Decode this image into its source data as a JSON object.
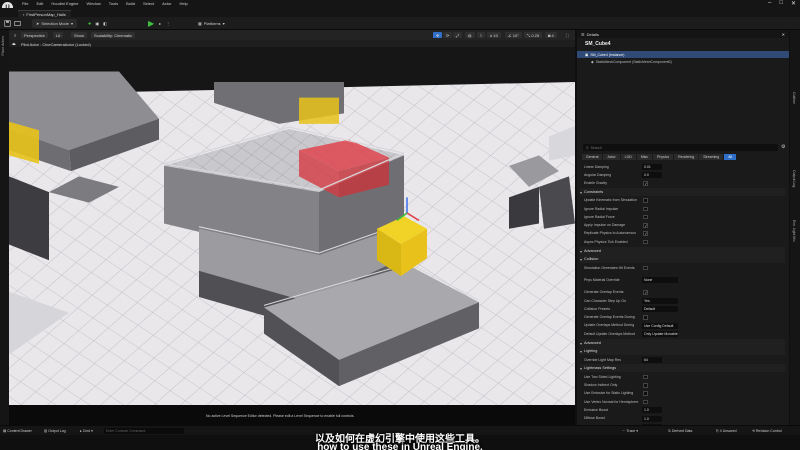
{
  "menubar": {
    "logo": "U",
    "items": [
      "File",
      "Edit",
      "Houdini Engine",
      "Window",
      "Tools",
      "Build",
      "Select",
      "Actor",
      "Help"
    ]
  },
  "tab": {
    "title": "FirstPersonMap_Halls"
  },
  "toolbar": {
    "mode": "Selection Mode",
    "platforms": "Platforms"
  },
  "left_strip": {
    "label": "Place Actors"
  },
  "viewport": {
    "perspective": "Perspective",
    "lit": "Lit",
    "show": "Show",
    "scalability": "Scalability: Cinematic",
    "grid_size": "10",
    "angle": "10°",
    "scale": "0.25",
    "speed": "4",
    "pilot_label": "Pilot Actor : CineCameraActor (Locked)",
    "sequence_message": "No active Level Sequence Editor detected. Please edit a Level Sequence to enable full controls."
  },
  "right_strip": {
    "labels": [
      "Outliner",
      "Output Log",
      "Env. Light Mix"
    ]
  },
  "details": {
    "title": "Details",
    "actor": "SM_Cube4",
    "instance": "SM_Cube4 (Instance)",
    "component": "StaticMeshComponent (StaticMeshComponent0)",
    "search_placeholder": "Search",
    "tabs": [
      "General",
      "Actor",
      "LOD",
      "Misc",
      "Physics",
      "Rendering",
      "Streaming",
      "All"
    ],
    "active_tab": "All",
    "rows": [
      {
        "label": "Linear Damping",
        "value": "0.01",
        "type": "val"
      },
      {
        "label": "Angular Damping",
        "value": "0.0",
        "type": "val"
      },
      {
        "label": "Enable Gravity",
        "value": "",
        "type": "chk_on"
      }
    ],
    "constraints_section": "Constraints",
    "constraint_rows": [
      {
        "label": "Update Kinematic from Simulation",
        "type": "chk"
      },
      {
        "label": "Ignore Radial Impulse",
        "type": "chk"
      },
      {
        "label": "Ignore Radial Force",
        "type": "chk"
      },
      {
        "label": "Apply Impulse on Damage",
        "type": "chk_on"
      },
      {
        "label": "Replicate Physics to Autonomous",
        "type": "chk_on"
      },
      {
        "label": "Async Physics Tick Enabled",
        "type": "chk"
      }
    ],
    "advanced1": "Advanced",
    "collision_section": "Collision",
    "collision_rows": [
      {
        "label": "Simulation Generates Hit Events",
        "type": "chk"
      },
      {
        "label": "Phys Material Override",
        "value": "None",
        "type": "dd"
      },
      {
        "label": "Generate Overlap Events",
        "type": "chk_on"
      },
      {
        "label": "Can Character Step Up On",
        "value": "Yes",
        "type": "dd"
      },
      {
        "label": "Collision Presets",
        "value": "Default",
        "type": "dd"
      },
      {
        "label": "Generate Overlap Events During",
        "type": "chk"
      },
      {
        "label": "Update Overlaps Method During",
        "value": "Use Config Default",
        "type": "dd"
      },
      {
        "label": "Default Update Overlaps Method",
        "value": "Only Update Movable",
        "type": "dd"
      }
    ],
    "advanced2": "Advanced",
    "lighting_section": "Lighting",
    "lighting_rows": [
      {
        "label": "Override Light Map Res",
        "value": "64",
        "type": "val"
      }
    ],
    "lightmass_section": "Lightmass Settings",
    "lightmass_rows": [
      {
        "label": "Use Two Sided Lighting",
        "type": "chk"
      },
      {
        "label": "Shadow Indirect Only",
        "type": "chk"
      },
      {
        "label": "Use Emissive for Static Lighting",
        "type": "chk"
      },
      {
        "label": "Use Vertex Normal for Hemisphere",
        "type": "chk"
      },
      {
        "label": "Emissive Boost",
        "value": "1.0",
        "type": "val"
      },
      {
        "label": "Diffuse Boost",
        "value": "1.0",
        "type": "val"
      },
      {
        "label": "Fully Occluded Samples Fraction",
        "value": "1.0",
        "type": "val"
      }
    ],
    "cast_shadow": "Cast Shadow"
  },
  "statusbar": {
    "content_drawer": "Content Drawer",
    "output_log": "Output Log",
    "cmd": "Cmd",
    "cmd_placeholder": "Enter Console Command",
    "trace": "Trace",
    "derived_data": "Derived Data",
    "unsaved": "4 Unsaved",
    "revision_control": "Revision Control"
  },
  "subtitle": {
    "cn": "以及如何在虚幻引擎中使用这些工具。",
    "en": "how to use these in Unreal Engine."
  },
  "colors": {
    "accent": "#2f6fc7",
    "play": "#3fbf3f",
    "highlight_red": "#e0454d",
    "highlight_yellow": "#e8c21a"
  }
}
